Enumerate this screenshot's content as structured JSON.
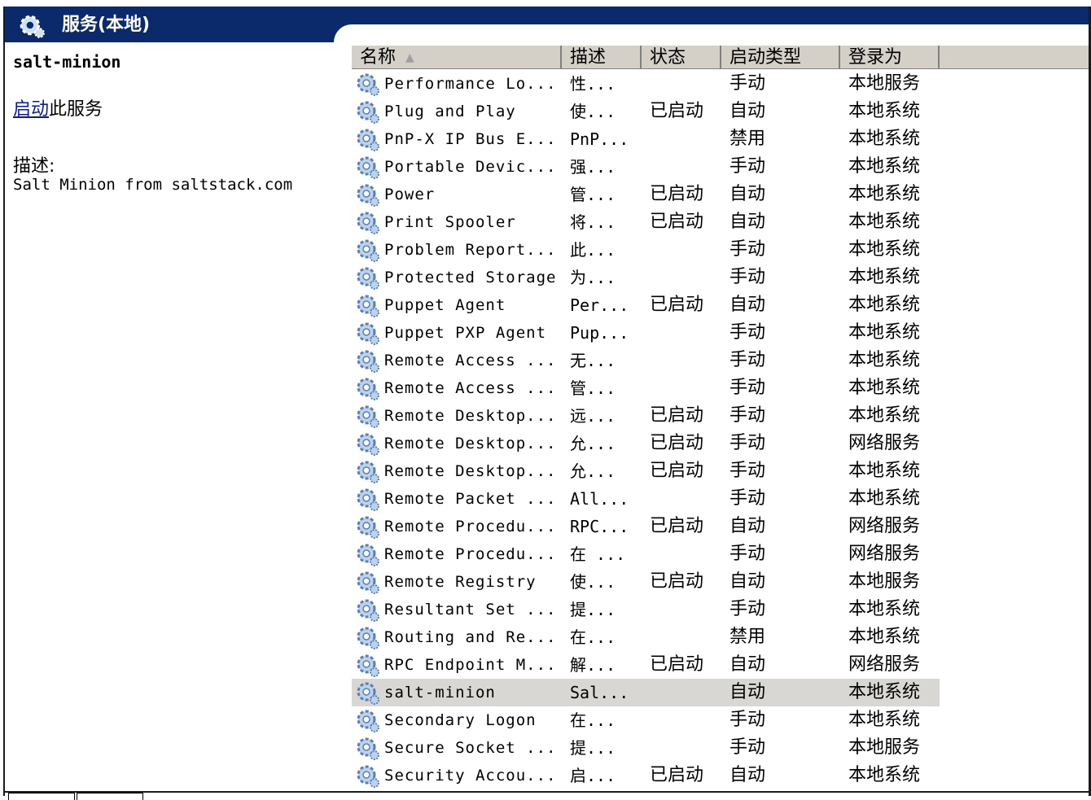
{
  "window": {
    "title": "服务(本地)",
    "icon": "gear-icon"
  },
  "left_pane": {
    "service_name": "salt-minion",
    "start_link": "启动",
    "start_suffix": "此服务",
    "desc_label": "描述:",
    "desc_text": "Salt Minion from saltstack.com"
  },
  "columns": {
    "name": "名称",
    "desc": "描述",
    "status": "状态",
    "startup": "启动类型",
    "logon": "登录为"
  },
  "rows": [
    {
      "name": "Performance Lo...",
      "desc": "性...",
      "status": "",
      "startup": "手动",
      "logon": "本地服务"
    },
    {
      "name": "Plug and Play",
      "desc": "使...",
      "status": "已启动",
      "startup": "自动",
      "logon": "本地系统"
    },
    {
      "name": "PnP-X IP Bus E...",
      "desc": "PnP...",
      "status": "",
      "startup": "禁用",
      "logon": "本地系统"
    },
    {
      "name": "Portable Devic...",
      "desc": "强...",
      "status": "",
      "startup": "手动",
      "logon": "本地系统"
    },
    {
      "name": "Power",
      "desc": "管...",
      "status": "已启动",
      "startup": "自动",
      "logon": "本地系统"
    },
    {
      "name": "Print Spooler",
      "desc": "将...",
      "status": "已启动",
      "startup": "自动",
      "logon": "本地系统"
    },
    {
      "name": "Problem Report...",
      "desc": "此...",
      "status": "",
      "startup": "手动",
      "logon": "本地系统"
    },
    {
      "name": "Protected Storage",
      "desc": "为...",
      "status": "",
      "startup": "手动",
      "logon": "本地系统"
    },
    {
      "name": "Puppet Agent",
      "desc": "Per...",
      "status": "已启动",
      "startup": "自动",
      "logon": "本地系统"
    },
    {
      "name": "Puppet PXP Agent",
      "desc": "Pup...",
      "status": "",
      "startup": "手动",
      "logon": "本地系统"
    },
    {
      "name": "Remote Access ...",
      "desc": "无...",
      "status": "",
      "startup": "手动",
      "logon": "本地系统"
    },
    {
      "name": "Remote Access ...",
      "desc": "管...",
      "status": "",
      "startup": "手动",
      "logon": "本地系统"
    },
    {
      "name": "Remote Desktop...",
      "desc": "远...",
      "status": "已启动",
      "startup": "手动",
      "logon": "本地系统"
    },
    {
      "name": "Remote Desktop...",
      "desc": "允...",
      "status": "已启动",
      "startup": "手动",
      "logon": "网络服务"
    },
    {
      "name": "Remote Desktop...",
      "desc": "允...",
      "status": "已启动",
      "startup": "手动",
      "logon": "本地系统"
    },
    {
      "name": "Remote Packet ...",
      "desc": "All...",
      "status": "",
      "startup": "手动",
      "logon": "本地系统"
    },
    {
      "name": "Remote Procedu...",
      "desc": "RPC...",
      "status": "已启动",
      "startup": "自动",
      "logon": "网络服务"
    },
    {
      "name": "Remote Procedu...",
      "desc": "在 ...",
      "status": "",
      "startup": "手动",
      "logon": "网络服务"
    },
    {
      "name": "Remote Registry",
      "desc": "使...",
      "status": "已启动",
      "startup": "自动",
      "logon": "本地服务"
    },
    {
      "name": "Resultant Set ...",
      "desc": "提...",
      "status": "",
      "startup": "手动",
      "logon": "本地系统"
    },
    {
      "name": "Routing and Re...",
      "desc": "在...",
      "status": "",
      "startup": "禁用",
      "logon": "本地系统"
    },
    {
      "name": "RPC Endpoint M...",
      "desc": "解...",
      "status": "已启动",
      "startup": "自动",
      "logon": "网络服务"
    },
    {
      "name": "salt-minion",
      "desc": "Sal...",
      "status": "",
      "startup": "自动",
      "logon": "本地系统",
      "selected": true
    },
    {
      "name": "Secondary Logon",
      "desc": "在...",
      "status": "",
      "startup": "手动",
      "logon": "本地系统"
    },
    {
      "name": "Secure Socket ...",
      "desc": "提...",
      "status": "",
      "startup": "手动",
      "logon": "本地服务"
    },
    {
      "name": "Security Accou...",
      "desc": "启...",
      "status": "已启动",
      "startup": "自动",
      "logon": "本地系统"
    }
  ]
}
